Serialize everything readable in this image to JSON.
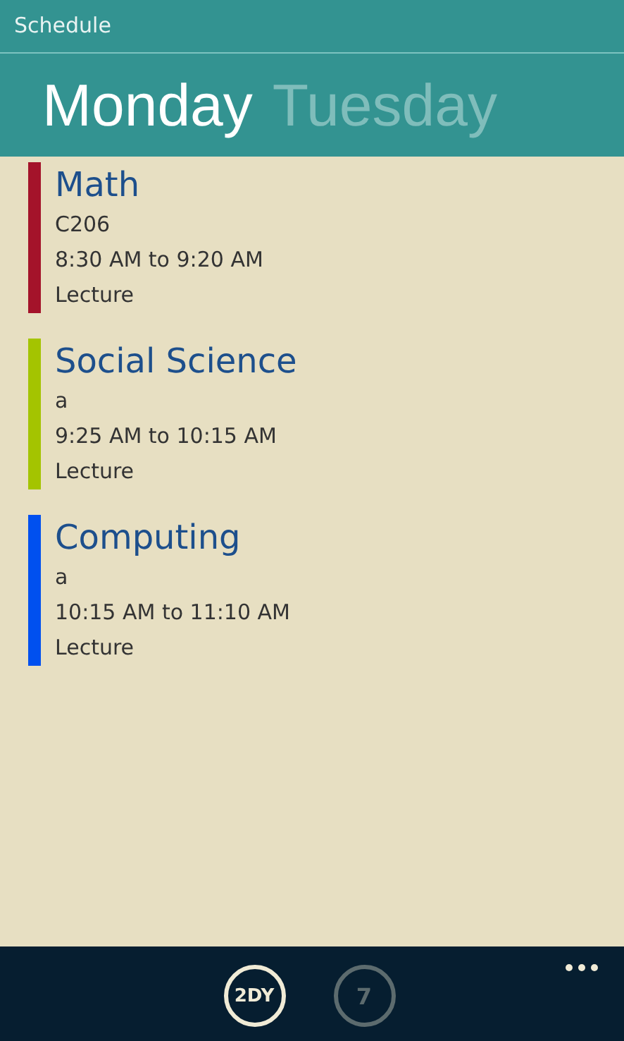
{
  "window": {
    "title": "Schedule"
  },
  "pivots": [
    {
      "label": "Monday",
      "selected": true
    },
    {
      "label": "Tuesday",
      "selected": false
    }
  ],
  "classes": [
    {
      "name": "Math",
      "room": "C206",
      "time": "8:30 AM to 9:20 AM",
      "type": "Lecture",
      "color": "#a4132a"
    },
    {
      "name": "Social Science",
      "room": "a",
      "time": "9:25 AM to 10:15 AM",
      "type": "Lecture",
      "color": "#a4c400"
    },
    {
      "name": "Computing",
      "room": "a",
      "time": "10:15 AM to 11:10 AM",
      "type": "Lecture",
      "color": "#0050ef"
    }
  ],
  "app_bar": {
    "buttons": [
      {
        "label": "2DY",
        "disabled": false
      },
      {
        "label": "7",
        "disabled": true
      }
    ]
  }
}
